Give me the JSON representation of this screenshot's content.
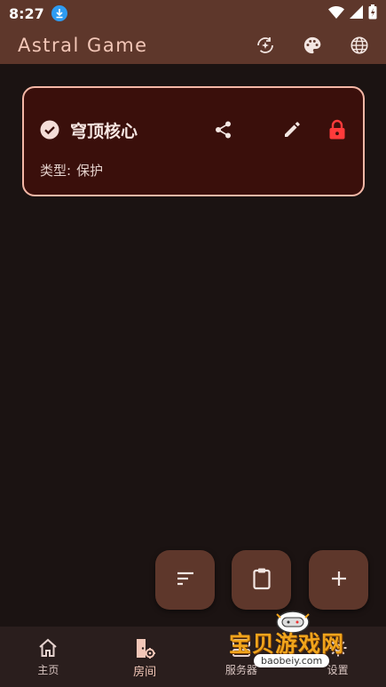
{
  "status_bar": {
    "time": "8:27"
  },
  "app_bar": {
    "title": "Astral Game",
    "actions": [
      "auto-awesome-icon",
      "palette-icon",
      "globe-icon"
    ]
  },
  "room_card": {
    "title": "穹顶核心",
    "type_label": "类型:",
    "type_value": "保护",
    "icons": [
      "check-circle-icon",
      "share-icon",
      "edit-icon",
      "lock-icon"
    ]
  },
  "fabs": [
    "sort-icon",
    "clipboard-icon",
    "plus-icon"
  ],
  "bottom_nav": {
    "items": [
      {
        "label": "主页",
        "icon": "home-icon"
      },
      {
        "label": "房间",
        "icon": "room-settings-icon",
        "active": true
      },
      {
        "label": "服务器",
        "icon": "server-icon"
      },
      {
        "label": "设置",
        "icon": "settings-icon"
      }
    ]
  },
  "watermark": {
    "text": "宝贝游戏网",
    "url": "baobeiy.com"
  },
  "colors": {
    "app_bar": "#5e372b",
    "background": "#1b1312",
    "card_bg": "#3a0f0b",
    "card_border": "#f4b7a6",
    "lock": "#ff3b3b",
    "accent_text": "#f3c7b8"
  }
}
